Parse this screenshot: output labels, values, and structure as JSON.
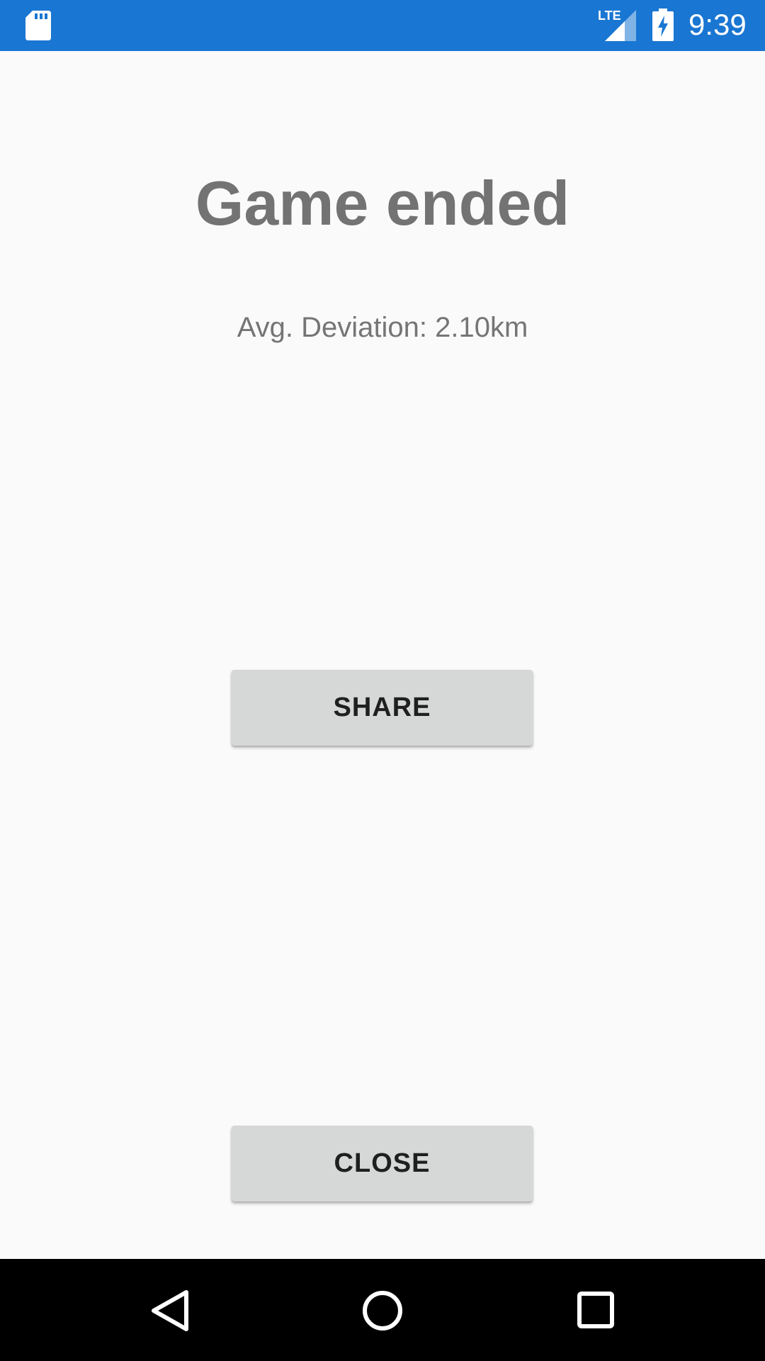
{
  "status_bar": {
    "time": "9:39",
    "network": "LTE",
    "icons": [
      "sd-card-icon",
      "lte-signal-icon",
      "battery-charging-icon"
    ],
    "background_color": "#1976d2"
  },
  "screen": {
    "title": "Game ended",
    "avg_deviation": "Avg. Deviation: 2.10km",
    "share_label": "SHARE",
    "close_label": "CLOSE"
  },
  "nav_bar": {
    "icons": [
      "back-icon",
      "home-icon",
      "recents-icon"
    ]
  },
  "colors": {
    "background": "#fafafa",
    "button": "#d6d7d7",
    "title_text": "#737373"
  }
}
